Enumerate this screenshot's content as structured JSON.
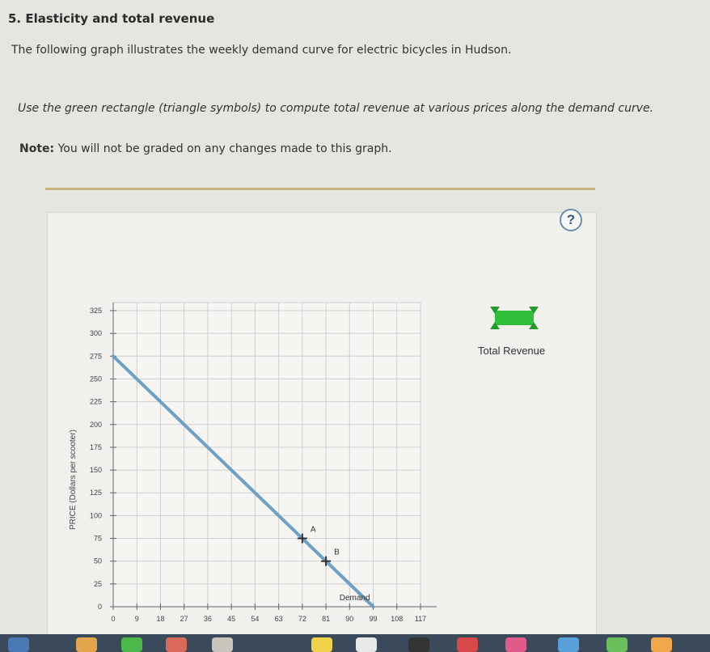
{
  "question": {
    "heading": "5. Elasticity and total revenue",
    "intro": "The following graph illustrates the weekly demand curve for electric bicycles in Hudson.",
    "instructions": "Use the green rectangle (triangle symbols) to compute total revenue at various prices along the demand curve.",
    "note_label": "Note:",
    "note_text": " You will not be graded on any changes made to this graph."
  },
  "help_button": {
    "label": "?"
  },
  "legend": {
    "total_revenue_label": "Total Revenue",
    "tool_icon": "green-rectangle-tool-icon"
  },
  "colors": {
    "demand": "#6e9fc7",
    "grid": "#cfcfcf",
    "tool": "#2fbf3a",
    "rule": "#c9b37c"
  },
  "chart_data": {
    "type": "line",
    "title": "",
    "ylabel": "PRICE (Dollars per scooter)",
    "xlabel": "",
    "x_ticks": [
      0,
      9,
      18,
      27,
      36,
      45,
      54,
      63,
      72,
      81,
      90,
      99,
      108,
      117
    ],
    "y_ticks": [
      0,
      25,
      50,
      75,
      100,
      125,
      150,
      175,
      200,
      225,
      250,
      275,
      300,
      325
    ],
    "xlim": [
      0,
      117
    ],
    "ylim": [
      0,
      325
    ],
    "grid": true,
    "series": [
      {
        "name": "Demand",
        "points": [
          [
            0,
            275
          ],
          [
            99,
            0
          ]
        ]
      }
    ],
    "points": [
      {
        "label": "A",
        "x": 72,
        "y": 75
      },
      {
        "label": "B",
        "x": 81,
        "y": 50
      }
    ]
  }
}
